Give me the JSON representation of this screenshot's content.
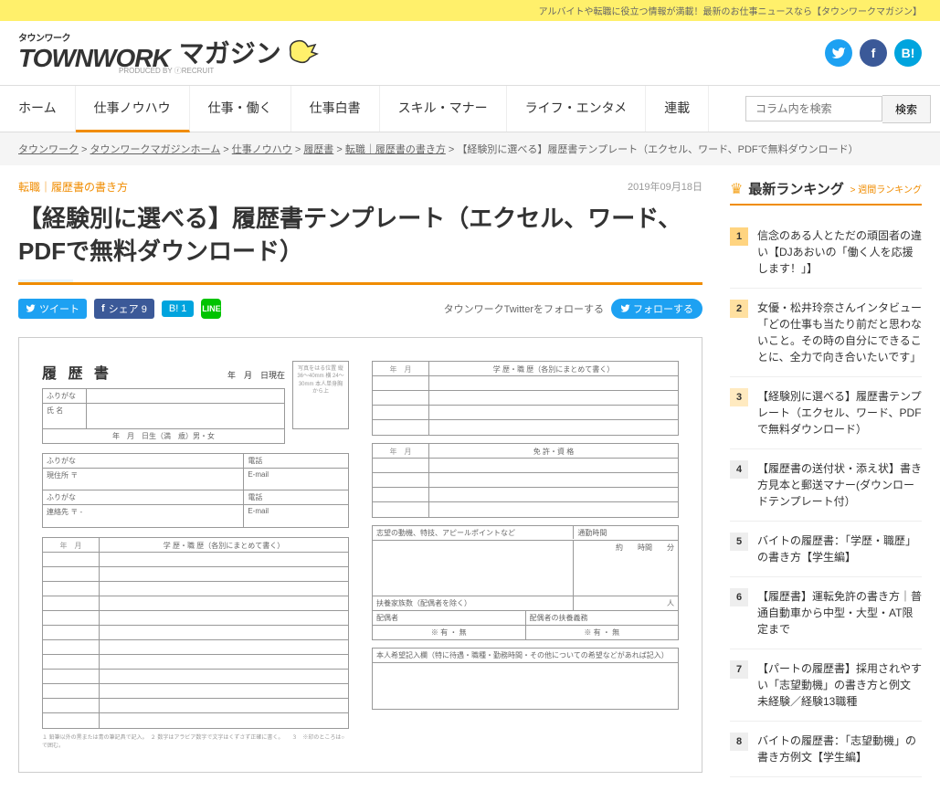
{
  "topbar": "アルバイトや転職に役立つ情報が満載！最新のお仕事ニュースなら【タウンワークマガジン】",
  "logo": {
    "top": "タウンワーク",
    "brand": "TOWNWORK",
    "mag": "マガジン",
    "sub": "PRODUCED BY ⓡRECRUIT"
  },
  "nav": {
    "items": [
      "ホーム",
      "仕事ノウハウ",
      "仕事・働く",
      "仕事白書",
      "スキル・マナー",
      "ライフ・エンタメ",
      "連載"
    ],
    "search_placeholder": "コラム内を検索",
    "search_btn": "検索"
  },
  "breadcrumb": {
    "parts": [
      "タウンワーク",
      "タウンワークマガジンホーム",
      "仕事ノウハウ",
      "履歴書",
      "転職｜履歴書の書き方"
    ],
    "current": "【経験別に選べる】履歴書テンプレート（エクセル、ワード、PDFで無料ダウンロード）"
  },
  "article": {
    "category": "転職｜履歴書の書き方",
    "date": "2019年09月18日",
    "title": "【経験別に選べる】履歴書テンプレート（エクセル、ワード、PDFで無料ダウンロード）",
    "share": {
      "tweet": "ツイート",
      "fb": "シェア 9",
      "hb": "B! 1",
      "line": "LINE"
    },
    "follow_text": "タウンワークTwitterをフォローする",
    "follow_btn": "フォローする"
  },
  "resume": {
    "heading": "履 歴 書",
    "date_label": "年　月　日現在",
    "photo_text": "写真をはる位置\n縦 36～40mm\n横 24～30mm\n本人単身胸から上",
    "furi": "ふりがな",
    "name": "氏 名",
    "birth": "年　月　日生（満　歳）男・女",
    "addr": "現住所 〒",
    "tel": "電話",
    "email": "E-mail",
    "contact": "連絡先 〒 -",
    "ym": "年　月",
    "edu_work": "学 歴・職 歴（各別にまとめて書く）",
    "license": "免 許・資 格",
    "reason": "志望の動機、特技、アピールポイントなど",
    "commute": "通勤時間",
    "commute_val": "約　　時間　　分",
    "dependents": "扶養家族数（配偶者を除く）",
    "people": "人",
    "spouse": "配偶者",
    "spouse_support": "配偶者の扶養義務",
    "yesno": "※ 有 ・ 無",
    "request": "本人希望記入欄（特に待遇・職種・勤務時間・その他についての希望などがあれば記入）",
    "note": "１ 鉛筆以外の黒または青の筆記具で記入。　２ 数字はアラビア数字で文字はくずさず正確に書く。　　３　※印のところは○で囲む。"
  },
  "ranking": {
    "title": "最新ランキング",
    "sub": "> 週間ランキング",
    "items": [
      "信念のある人とただの頑固者の違い【DJあおいの「働く人を応援します！」】",
      "女優・松井玲奈さんインタビュー「どの仕事も当たり前だと思わないこと。その時の自分にできることに、全力で向き合いたいです」",
      "【経験別に選べる】履歴書テンプレート（エクセル、ワード、PDFで無料ダウンロード）",
      "【履歴書の送付状・添え状】書き方見本と郵送マナー(ダウンロードテンプレート付）",
      "バイトの履歴書：「学歴・職歴」の書き方【学生編】",
      "【履歴書】運転免許の書き方｜普通自動車から中型・大型・AT限定まで",
      "【パートの履歴書】採用されやすい「志望動機」の書き方と例文 未経験／経験13職種",
      "バイトの履歴書：「志望動機」の書き方例文【学生編】"
    ]
  }
}
